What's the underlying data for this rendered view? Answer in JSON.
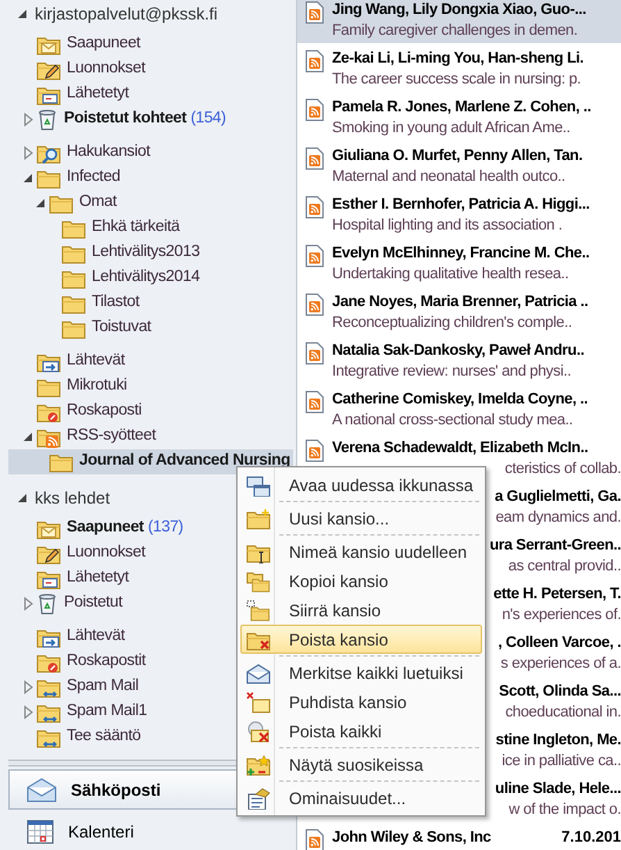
{
  "accounts": [
    {
      "name": "kirjastopalvelut@pkssk.fi",
      "expanded": true,
      "groups": [
        [
          {
            "name": "Saapuneet",
            "kind": "inbox",
            "unread": false,
            "selected": false
          },
          {
            "name": "Luonnokset",
            "kind": "drafts",
            "unread": false,
            "selected": false
          },
          {
            "name": "Lähetetyt",
            "kind": "sent",
            "unread": false,
            "selected": false
          },
          {
            "name": "Poistetut kohteet",
            "kind": "deleted",
            "unread": true,
            "count": "(154)",
            "expanded": false,
            "selected": false
          }
        ],
        [
          {
            "name": "Hakukansiot",
            "kind": "search",
            "unread": false,
            "expanded": false,
            "selected": false
          },
          {
            "name": "Infected",
            "kind": "folder",
            "unread": false,
            "expanded": true,
            "selected": false,
            "children": [
              {
                "name": "Omat",
                "kind": "folder",
                "unread": false,
                "expanded": true,
                "selected": false,
                "children": [
                  {
                    "name": "Ehkä tärkeitä",
                    "kind": "folder",
                    "unread": false,
                    "selected": false
                  },
                  {
                    "name": "Lehtivälitys2013",
                    "kind": "folder",
                    "unread": false,
                    "selected": false
                  },
                  {
                    "name": "Lehtivälitys2014",
                    "kind": "folder",
                    "unread": false,
                    "selected": false
                  },
                  {
                    "name": "Tilastot",
                    "kind": "folder",
                    "unread": false,
                    "selected": false
                  },
                  {
                    "name": "Toistuvat",
                    "kind": "folder",
                    "unread": false,
                    "selected": false
                  }
                ]
              }
            ]
          }
        ],
        [
          {
            "name": "Lähtevät",
            "kind": "outbox",
            "unread": false,
            "selected": false
          },
          {
            "name": "Mikrotuki",
            "kind": "folder",
            "unread": false,
            "selected": false
          },
          {
            "name": "Roskaposti",
            "kind": "junk",
            "unread": false,
            "selected": false
          },
          {
            "name": "RSS-syötteet",
            "kind": "rss",
            "unread": false,
            "expanded": true,
            "selected": false,
            "children": [
              {
                "name": "Journal of Advanced Nursing",
                "kind": "folder",
                "unread": true,
                "selected": true
              }
            ]
          }
        ]
      ]
    },
    {
      "name": "kks lehdet",
      "expanded": true,
      "groups": [
        [
          {
            "name": "Saapuneet",
            "kind": "inbox",
            "unread": true,
            "count": "(137)",
            "selected": false
          },
          {
            "name": "Luonnokset",
            "kind": "drafts",
            "unread": false,
            "selected": false
          },
          {
            "name": "Lähetetyt",
            "kind": "sent",
            "unread": false,
            "selected": false
          },
          {
            "name": "Poistetut",
            "kind": "deleted",
            "unread": false,
            "expanded": false,
            "selected": false
          }
        ],
        [
          {
            "name": "Lähtevät",
            "kind": "outbox",
            "unread": false,
            "selected": false
          },
          {
            "name": "Roskapostit",
            "kind": "junk",
            "unread": false,
            "selected": false
          },
          {
            "name": "Spam Mail",
            "kind": "sync",
            "unread": false,
            "expanded": false,
            "selected": false
          },
          {
            "name": "Spam Mail1",
            "kind": "sync",
            "unread": false,
            "expanded": false,
            "selected": false
          },
          {
            "name": "Tee sääntö",
            "kind": "sync",
            "unread": false,
            "selected": false
          }
        ]
      ]
    }
  ],
  "nav_buttons": [
    {
      "label": "Sähköposti",
      "kind": "mail",
      "selected": true
    },
    {
      "label": "Kalenteri",
      "kind": "calendar",
      "selected": false
    }
  ],
  "messages": [
    {
      "sender": "Jing Wang, Lily Dongxia Xiao, Guo-...",
      "title": "Family caregiver challenges in demen.",
      "kind": "full",
      "selected": true
    },
    {
      "sender": "Ze-kai Li, Li-ming You, Han-sheng Li.",
      "title": "The career success scale in nursing: p.",
      "kind": "full",
      "selected": false
    },
    {
      "sender": "Pamela R. Jones, Marlene Z. Cohen, ..",
      "title": "Smoking in young adult African Ame..",
      "kind": "full",
      "selected": false
    },
    {
      "sender": "Giuliana O. Murfet, Penny Allen, Tan.",
      "title": "Maternal and neonatal health outco..",
      "kind": "full",
      "selected": false
    },
    {
      "sender": "Esther I. Bernhofer, Patricia A. Higgi...",
      "title": "Hospital lighting and its association .",
      "kind": "full",
      "selected": false
    },
    {
      "sender": "Evelyn McElhinney, Francine M. Che..",
      "title": "Undertaking qualitative health resea..",
      "kind": "full",
      "selected": false
    },
    {
      "sender": "Jane Noyes, Maria Brenner, Patricia ..",
      "title": "Reconceptualizing children's comple..",
      "kind": "full",
      "selected": false
    },
    {
      "sender": "Natalia Sak-Dankosky, Paweł Andru..",
      "title": "Integrative review: nurses' and physi..",
      "kind": "full",
      "selected": false
    },
    {
      "sender": "Catherine Comiskey, Imelda Coyne, ..",
      "title": "A national cross-sectional study mea..",
      "kind": "full",
      "selected": false
    },
    {
      "sender": "Verena Schadewaldt, Elizabeth McIn..",
      "title": "cteristics of collab.",
      "kind": "half-covered",
      "selected": false
    },
    {
      "sender": "a Guglielmetti, Ga.",
      "title": "eam dynamics and.",
      "kind": "covered",
      "selected": false
    },
    {
      "sender": "ura Serrant-Green..",
      "title": "as central provid..",
      "kind": "covered",
      "selected": false
    },
    {
      "sender": "ette H. Petersen, T.",
      "title": "n's experiences of.",
      "kind": "covered",
      "selected": false
    },
    {
      "sender": ", Colleen Varcoe, .",
      "title": "s experiences of a.",
      "kind": "covered",
      "selected": false
    },
    {
      "sender": "Scott, Olinda Sa...",
      "title": "choeducational in.",
      "kind": "covered",
      "selected": false
    },
    {
      "sender": "stine Ingleton, Me.",
      "title": "ice in palliative ca..",
      "kind": "covered",
      "selected": false
    },
    {
      "sender": "uline Slade, Hele...",
      "title": "w of the impact o.",
      "kind": "covered",
      "selected": false
    },
    {
      "sender": "John Wiley & Sons, Inc",
      "date": "7.10.201",
      "kind": "full",
      "selected": false
    }
  ],
  "context_menu": [
    {
      "label": "Avaa uudessa ikkunassa",
      "kind": "open-window",
      "selected": false
    },
    {
      "label": "Uusi kansio...",
      "kind": "new-folder",
      "separator_before": true,
      "selected": false
    },
    {
      "label": "Nimeä kansio uudelleen",
      "kind": "rename",
      "separator_before": true,
      "selected": false
    },
    {
      "label": "Kopioi kansio",
      "kind": "copy",
      "selected": false
    },
    {
      "label": "Siirrä kansio",
      "kind": "move",
      "selected": false
    },
    {
      "label": "Poista kansio",
      "kind": "delete",
      "selected": true
    },
    {
      "label": "Merkitse kaikki luetuiksi",
      "kind": "mark-read",
      "separator_before": true,
      "selected": false
    },
    {
      "label": "Puhdista kansio",
      "kind": "clean",
      "selected": false
    },
    {
      "label": "Poista kaikki",
      "kind": "delete-all",
      "selected": false
    },
    {
      "label": "Näytä suosikeissa",
      "kind": "favorite",
      "separator_before": true,
      "selected": false
    },
    {
      "label": "Ominaisuudet...",
      "kind": "properties",
      "separator_before": true,
      "selected": false
    }
  ]
}
